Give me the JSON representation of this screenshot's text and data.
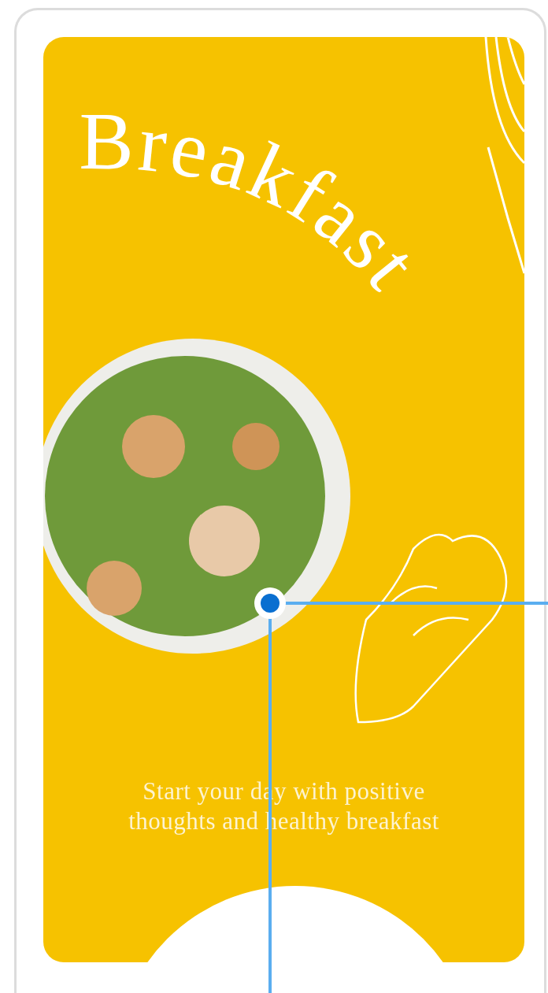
{
  "title": "Breakfast",
  "tagline_lines": [
    "Start your day with positive",
    "thoughts and healthy breakfast"
  ]
}
